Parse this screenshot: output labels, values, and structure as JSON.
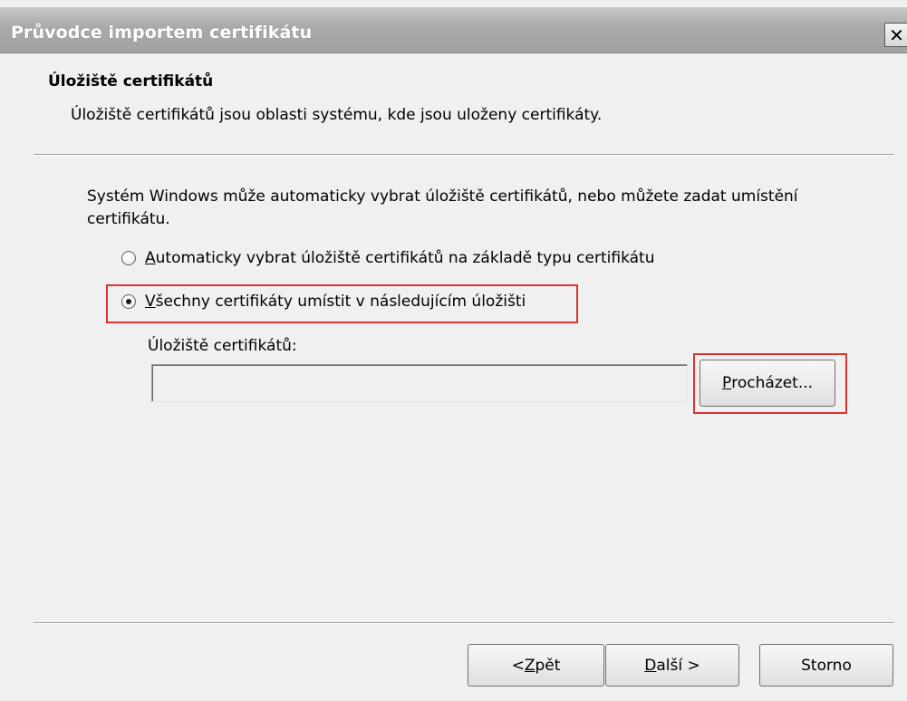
{
  "window": {
    "title": "Průvodce importem certifikátu",
    "close_icon": "✕"
  },
  "header": {
    "heading": "Úložiště certifikátů",
    "description": "Úložiště certifikátů jsou oblasti systému, kde jsou uloženy certifikáty."
  },
  "body": {
    "intro": "Systém Windows může automaticky vybrat úložiště certifikátů, nebo můžete zadat umístění certifikátu.",
    "radio_auto": {
      "mnemonic": "A",
      "rest": "utomaticky vybrat úložiště certifikátů na základě typu certifikátu",
      "checked": false
    },
    "radio_manual": {
      "mnemonic": "V",
      "rest": "šechny certifikáty umístit v následujícím úložišti",
      "checked": true
    },
    "store_label": "Úložiště certifikátů:",
    "store_value": "",
    "browse": {
      "mnemonic": "P",
      "rest": "rocházet..."
    }
  },
  "footer": {
    "back": {
      "prefix": "< ",
      "mnemonic": "Z",
      "rest": "pět"
    },
    "next": {
      "mnemonic": "D",
      "rest": "alší >"
    },
    "cancel": "Storno"
  },
  "colors": {
    "highlight": "#e03131",
    "titlebar": "#a9a9a9",
    "dialog_bg": "#f0f0f0"
  }
}
